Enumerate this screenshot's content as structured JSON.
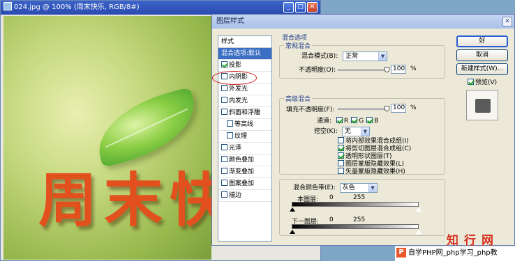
{
  "doc_window": {
    "title": "024.jpg @ 100% (周末快乐, RGB/8#)",
    "canvas_text": "周末快"
  },
  "dialog": {
    "title": "图层样式",
    "left_list": {
      "header": "样式",
      "items": [
        {
          "label": "混合选项:默认",
          "checkbox": false,
          "checked": false,
          "selected": true
        },
        {
          "label": "投影",
          "checkbox": true,
          "checked": true,
          "selected": false
        },
        {
          "label": "内阴影",
          "checkbox": true,
          "checked": false,
          "selected": false
        },
        {
          "label": "外发光",
          "checkbox": true,
          "checked": false,
          "selected": false
        },
        {
          "label": "内发光",
          "checkbox": true,
          "checked": false,
          "selected": false
        },
        {
          "label": "斜面和浮雕",
          "checkbox": true,
          "checked": false,
          "selected": false
        },
        {
          "label": "等高线",
          "checkbox": true,
          "checked": false,
          "selected": false,
          "sub": true
        },
        {
          "label": "纹理",
          "checkbox": true,
          "checked": false,
          "selected": false,
          "sub": true
        },
        {
          "label": "光泽",
          "checkbox": true,
          "checked": false,
          "selected": false
        },
        {
          "label": "颜色叠加",
          "checkbox": true,
          "checked": false,
          "selected": false
        },
        {
          "label": "渐变叠加",
          "checkbox": true,
          "checked": false,
          "selected": false
        },
        {
          "label": "图案叠加",
          "checkbox": true,
          "checked": false,
          "selected": false
        },
        {
          "label": "描边",
          "checkbox": true,
          "checked": false,
          "selected": false
        }
      ]
    },
    "blend_options": {
      "section_title": "混合选项",
      "general": {
        "legend": "常规混合",
        "blend_mode_label": "混合模式(B):",
        "blend_mode_value": "正常",
        "opacity_label": "不透明度(O):",
        "opacity_value": "100",
        "opacity_unit": "%",
        "opacity_level": 1.0
      },
      "advanced": {
        "legend": "高级混合",
        "fill_opacity_label": "填充不透明度(F):",
        "fill_opacity_value": "100",
        "fill_opacity_unit": "%",
        "fill_opacity_level": 1.0,
        "channels_label": "通道:",
        "channels": [
          {
            "label": "R",
            "checked": true
          },
          {
            "label": "G",
            "checked": true
          },
          {
            "label": "B",
            "checked": true
          }
        ],
        "knockout_label": "挖空(K):",
        "knockout_value": "无",
        "options": [
          {
            "label": "将内部效果混合成组(I)",
            "checked": false
          },
          {
            "label": "将剪切图层混合成组(C)",
            "checked": true
          },
          {
            "label": "透明形状图层(T)",
            "checked": true
          },
          {
            "label": "图层蒙版隐藏效果(L)",
            "checked": false
          },
          {
            "label": "矢量蒙版隐藏效果(H)",
            "checked": false
          }
        ]
      },
      "blend_if": {
        "label": "混合颜色带(E):",
        "value": "灰色",
        "this_layer_label": "本图层:",
        "this_layer_low": "0",
        "this_layer_high": "255",
        "underlying_label": "下一图层:",
        "underlying_low": "0",
        "underlying_high": "255"
      }
    },
    "buttons": {
      "ok": "好",
      "cancel": "取消",
      "new_style": "新建样式(W)...",
      "preview_label": "预览(V)",
      "preview_checked": true
    }
  },
  "watermark": {
    "logo": "知行网",
    "bar_icon": "P",
    "bar_text": "自学PHP网_php学习_php教"
  },
  "colors": {
    "accent_selected": "#3b6fc4",
    "canvas_text": "#e2511d",
    "annotation_circle": "#d21b1b"
  }
}
